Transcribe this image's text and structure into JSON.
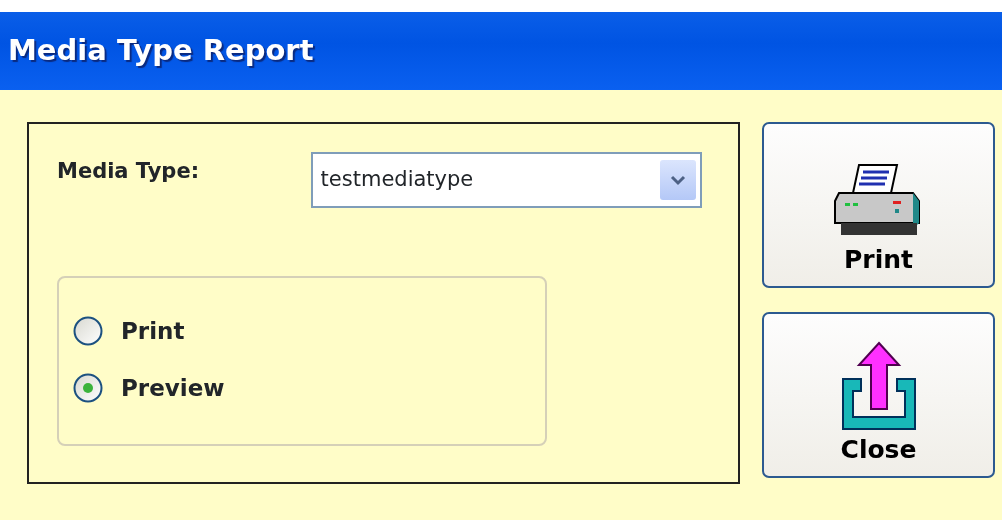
{
  "window": {
    "title": "Media Type Report"
  },
  "media_type": {
    "label": "Media Type:",
    "value": "testmediatype"
  },
  "output_options": [
    {
      "label": "Print",
      "selected": false
    },
    {
      "label": "Preview",
      "selected": true
    }
  ],
  "buttons": [
    {
      "kind": "print",
      "label": "Print"
    },
    {
      "kind": "close",
      "label": "Close"
    }
  ]
}
